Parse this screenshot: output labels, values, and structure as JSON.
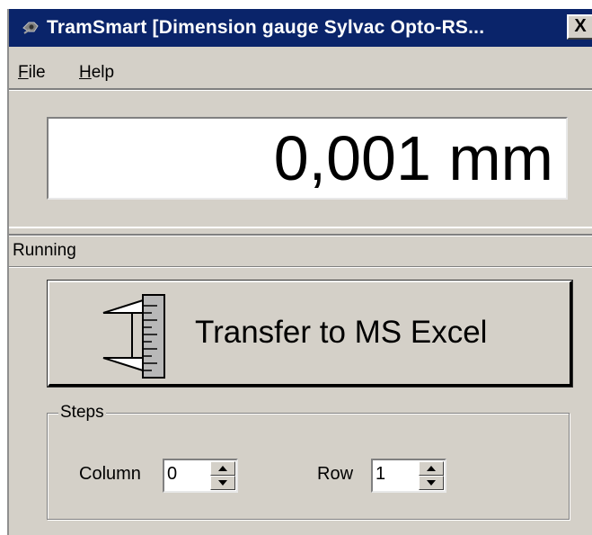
{
  "window": {
    "title": "TramSmart [Dimension gauge Sylvac Opto-RS...",
    "close_label": "X"
  },
  "menu": {
    "file": {
      "first": "F",
      "rest": "ile"
    },
    "help": {
      "first": "H",
      "rest": "elp"
    }
  },
  "display": {
    "value": "0,001 mm"
  },
  "status": {
    "text": "Running"
  },
  "transfer": {
    "label": "Transfer to MS Excel",
    "icon": "caliper-icon"
  },
  "steps": {
    "legend": "Steps",
    "column_label": "Column",
    "column_value": "0",
    "row_label": "Row",
    "row_value": "1"
  },
  "colors": {
    "titlebar": "#0a246a",
    "face": "#d4d0c8"
  }
}
